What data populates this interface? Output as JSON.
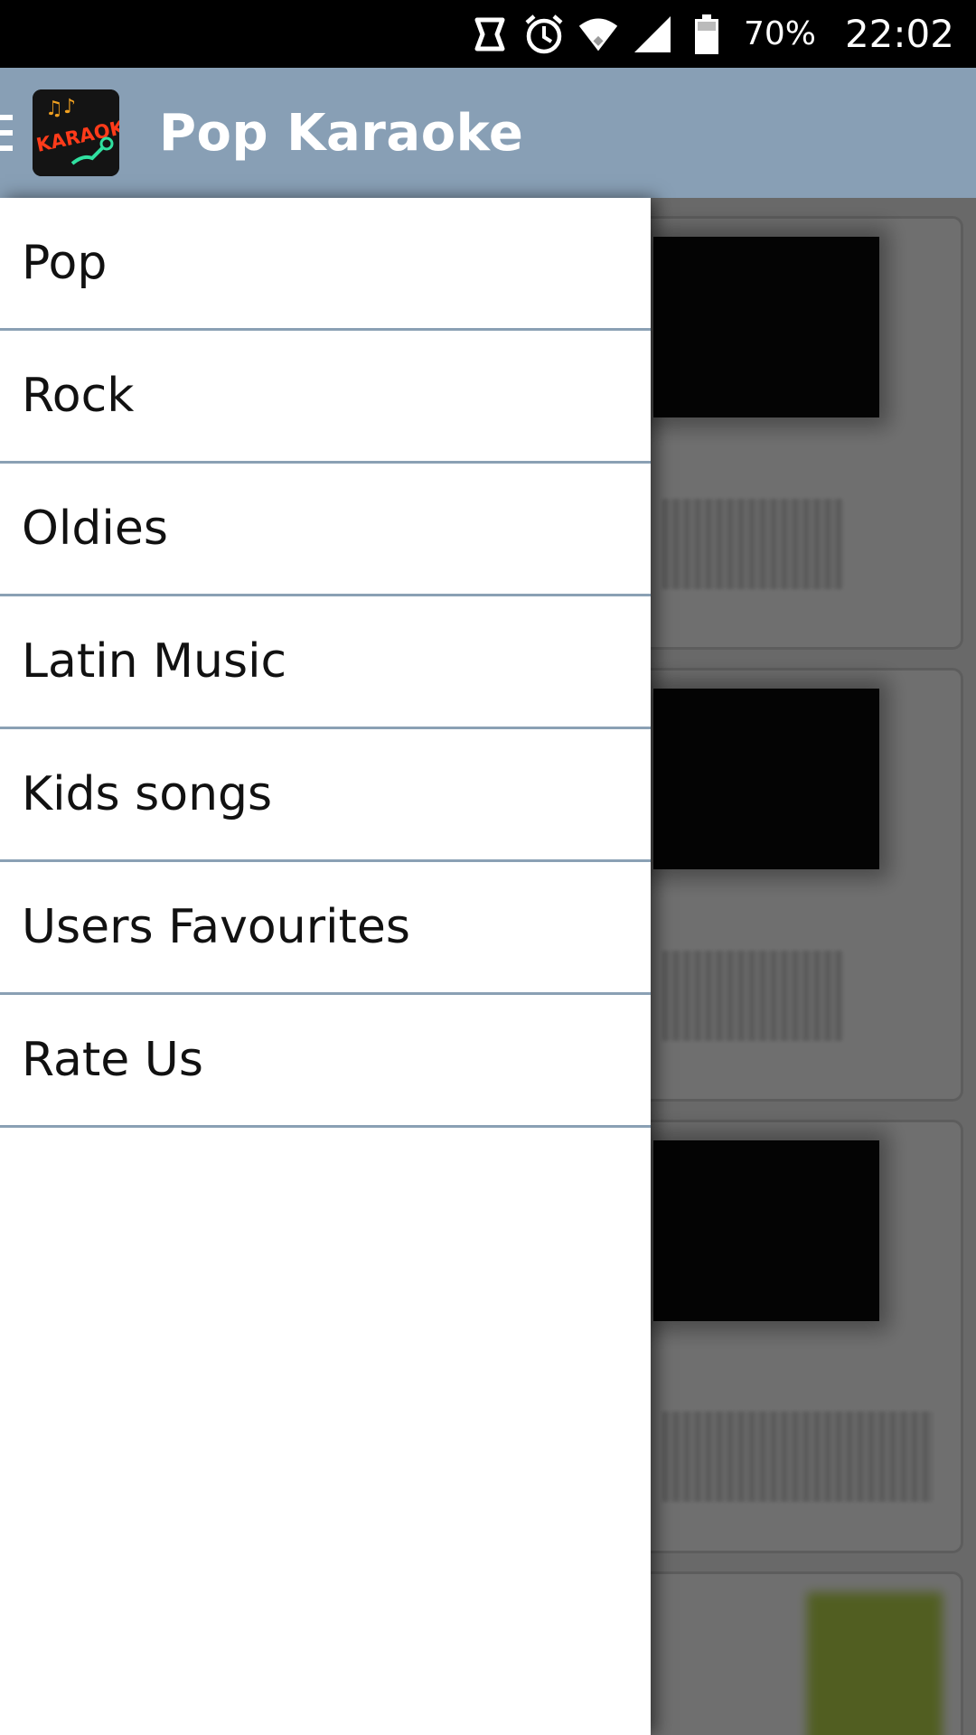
{
  "status_bar": {
    "battery_percent": "70%",
    "time": "22:02",
    "icons": [
      "sync-icon",
      "alarm-icon",
      "wifi-icon",
      "signal-icon",
      "battery-icon"
    ]
  },
  "app_bar": {
    "title": "Pop Karaoke",
    "logo_text": "KARAOKE",
    "background_color": "#889fb5"
  },
  "drawer": {
    "items": [
      {
        "label": "Pop"
      },
      {
        "label": "Rock"
      },
      {
        "label": "Oldies"
      },
      {
        "label": "Latin Music"
      },
      {
        "label": "Kids songs"
      },
      {
        "label": "Users Favourites"
      },
      {
        "label": "Rate Us"
      }
    ],
    "divider_color": "#8aa0b4"
  }
}
